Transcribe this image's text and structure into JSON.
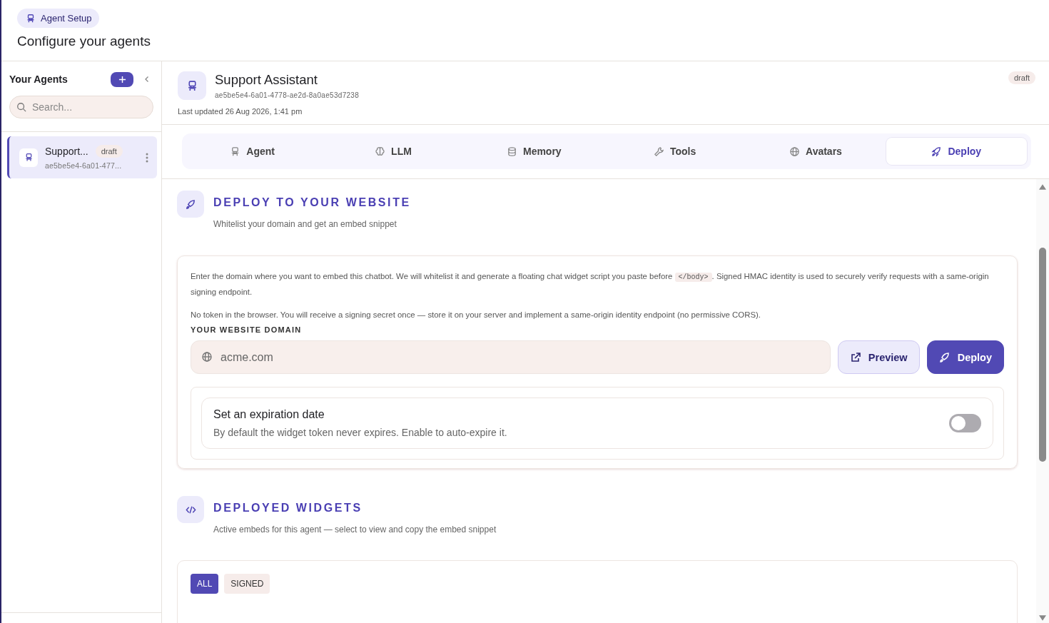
{
  "page": {
    "badge": "Agent Setup",
    "title": "Configure your agents"
  },
  "sidebar": {
    "title": "Your Agents",
    "search": {
      "placeholder": "Search..."
    },
    "agents": [
      {
        "name": "Support...",
        "status": "draft",
        "id": "ae5be5e4-6a01-477...",
        "selected": true
      }
    ]
  },
  "agent": {
    "name": "Support Assistant",
    "id": "ae5be5e4-6a01-4778-ae2d-8a0ae53d7238",
    "updated": "Last updated 26 Aug 2026, 1:41 pm",
    "status": "draft"
  },
  "tabs": [
    {
      "label": "Agent",
      "kind": "robot",
      "selected": false
    },
    {
      "label": "LLM",
      "kind": "brain",
      "selected": false
    },
    {
      "label": "Memory",
      "kind": "database",
      "selected": false
    },
    {
      "label": "Tools",
      "kind": "wrench",
      "selected": false
    },
    {
      "label": "Avatars",
      "kind": "globe",
      "selected": false
    },
    {
      "label": "Deploy",
      "kind": "rocket",
      "selected": true
    }
  ],
  "deploy": {
    "title": "DEPLOY TO YOUR WEBSITE",
    "subtitle": "Whitelist your domain and get an embed snippet",
    "intro_before": "Enter the domain where you want to embed this chatbot. We will whitelist it and generate a floating chat widget script you paste before",
    "intro_code": "</body>",
    "intro_after": ". Signed HMAC identity is used to securely verify requests with a same-origin signing endpoint.",
    "note": "No token in the browser. You will receive a signing secret once — store it on your server and implement a same-origin identity endpoint (no permissive CORS).",
    "domain_label": "YOUR WEBSITE DOMAIN",
    "domain": {
      "value": "acme.com"
    },
    "buttons": [
      {
        "label": "Preview",
        "kind": "secondary"
      },
      {
        "label": "Deploy",
        "kind": "primary"
      }
    ],
    "expiration": {
      "title": "Set an expiration date",
      "description": "By default the widget token never expires. Enable to auto-expire it.",
      "on": false
    }
  },
  "widgets": {
    "title": "DEPLOYED WIDGETS",
    "subtitle": "Active embeds for this agent — select to view and copy the embed snippet",
    "filters": [
      {
        "label": "ALL",
        "selected": true
      },
      {
        "label": "SIGNED",
        "selected": false
      }
    ]
  }
}
